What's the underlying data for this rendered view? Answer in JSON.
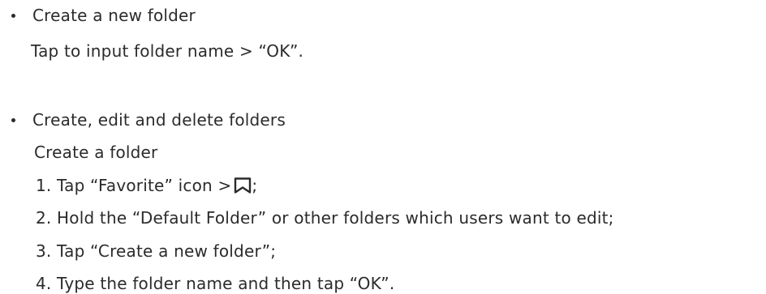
{
  "section1": {
    "heading": "Create a new folder",
    "text": "Tap to input folder name >  “OK”."
  },
  "section2": {
    "heading": "Create, edit and delete folders",
    "subheading": "Create a folder",
    "step1_before_icon": "1. Tap  “Favorite”  icon >",
    "step1_after_icon": ";",
    "step1_icon": "bookmark-icon",
    "step2": "2. Hold the  “Default Folder”  or other folders which users want to edit;",
    "step3": "3. Tap  “Create a new folder”;",
    "step4": "4. Type the folder name and then tap  “OK”."
  }
}
